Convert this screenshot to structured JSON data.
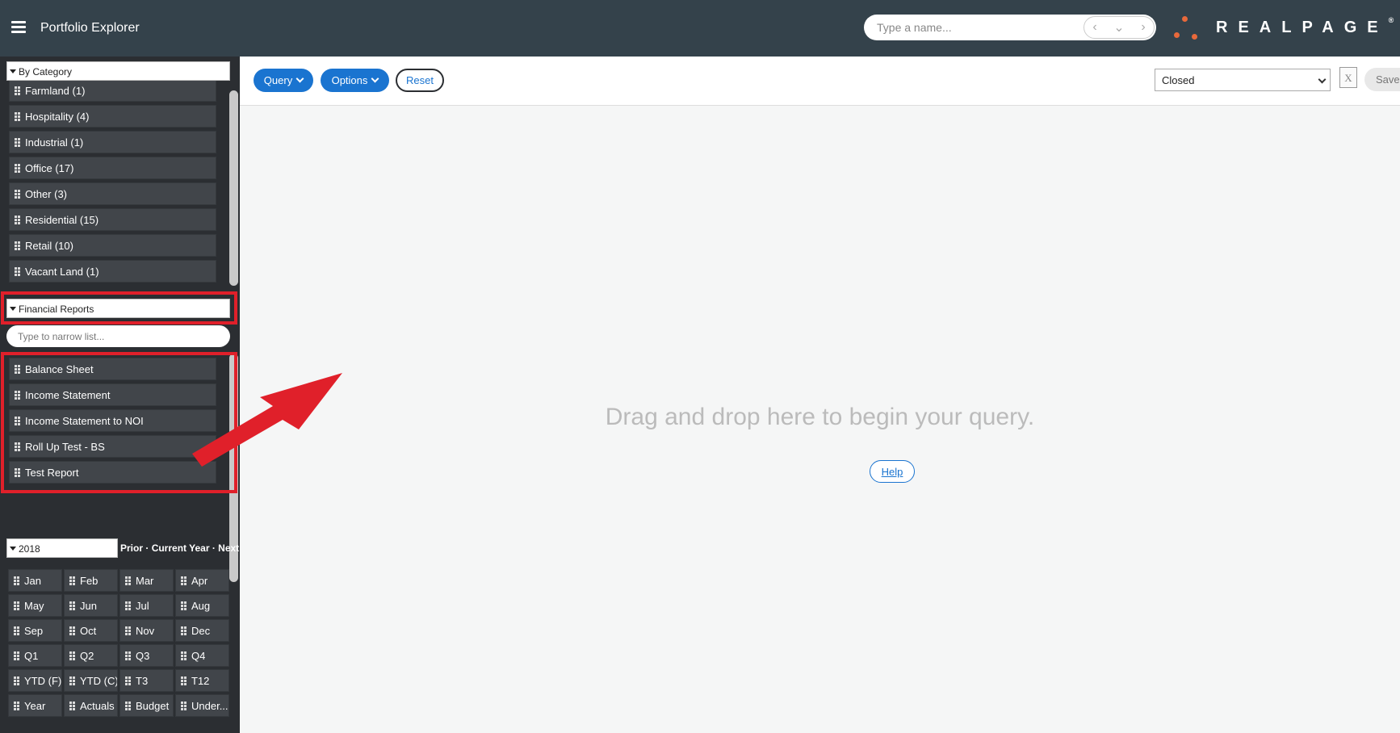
{
  "header": {
    "title": "Portfolio Explorer",
    "search_placeholder": "Type a name...",
    "brand": "REALPAGE",
    "brand_mark": "®"
  },
  "sidebar": {
    "category_section": "By Category",
    "categories": [
      "Farmland (1)",
      "Hospitality (4)",
      "Industrial (1)",
      "Office (17)",
      "Other (3)",
      "Residential (15)",
      "Retail (10)",
      "Vacant Land (1)"
    ],
    "reports_section": "Financial Reports",
    "narrow_placeholder": "Type to narrow list...",
    "reports": [
      "Balance Sheet",
      "Income Statement",
      "Income Statement to NOI",
      "Roll Up Test - BS",
      "Test Report"
    ],
    "year": "2018",
    "year_nav": {
      "prior": "Prior",
      "current": "Current Year",
      "next": "Next",
      "sep": " · "
    },
    "periods": [
      "Jan",
      "Feb",
      "Mar",
      "Apr",
      "May",
      "Jun",
      "Jul",
      "Aug",
      "Sep",
      "Oct",
      "Nov",
      "Dec",
      "Q1",
      "Q2",
      "Q3",
      "Q4",
      "YTD (F)",
      "YTD (C)",
      "T3",
      "T12",
      "Year",
      "Actuals",
      "Budget",
      "Under..."
    ]
  },
  "toolbar": {
    "query_label": "Query",
    "options_label": "Options",
    "reset_label": "Reset",
    "status_value": "Closed",
    "excel_glyph": "X",
    "save_label": "Save A"
  },
  "main": {
    "drop_text": "Drag and drop here to begin your query.",
    "help_label": "Help"
  },
  "colors": {
    "header_bg": "#34424b",
    "sidebar_bg": "#2b2e32",
    "tile_bg": "#41454a",
    "accent_blue": "#1a74d0",
    "brand_orange": "#e8693b",
    "highlight_red": "#e0202a"
  }
}
